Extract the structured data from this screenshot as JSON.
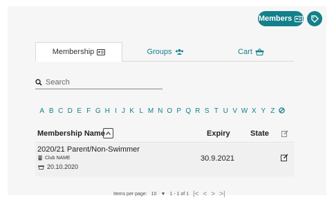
{
  "top_actions": {
    "members_label": "Members",
    "members_icon": "id-card-icon",
    "tag_icon": "tag-icon"
  },
  "tabs": [
    {
      "label": "Membership",
      "icon": "id-card-icon",
      "active": true
    },
    {
      "label": "Groups",
      "icon": "users-icon",
      "active": false
    },
    {
      "label": "Cart",
      "icon": "basket-icon",
      "active": false
    }
  ],
  "search": {
    "placeholder": "Search",
    "value": ""
  },
  "alphabet": [
    "A",
    "B",
    "C",
    "D",
    "E",
    "F",
    "G",
    "H",
    "I",
    "J",
    "K",
    "L",
    "M",
    "N",
    "O",
    "P",
    "Q",
    "R",
    "S",
    "T",
    "U",
    "V",
    "W",
    "X",
    "Y",
    "Z"
  ],
  "table": {
    "headers": {
      "name": "Membership Name",
      "expiry": "Expiry",
      "state": "State"
    },
    "rows": [
      {
        "name": "2020/21 Parent/Non-Swimmer",
        "club": "Club NAME",
        "date": "20.10.2020",
        "expiry": "30.9.2021",
        "state": ""
      }
    ]
  },
  "pager": {
    "items_per_page_label": "Items per page:",
    "items_per_page": "10",
    "range": "1 - 1 of 1"
  },
  "colors": {
    "accent": "#14808c"
  }
}
